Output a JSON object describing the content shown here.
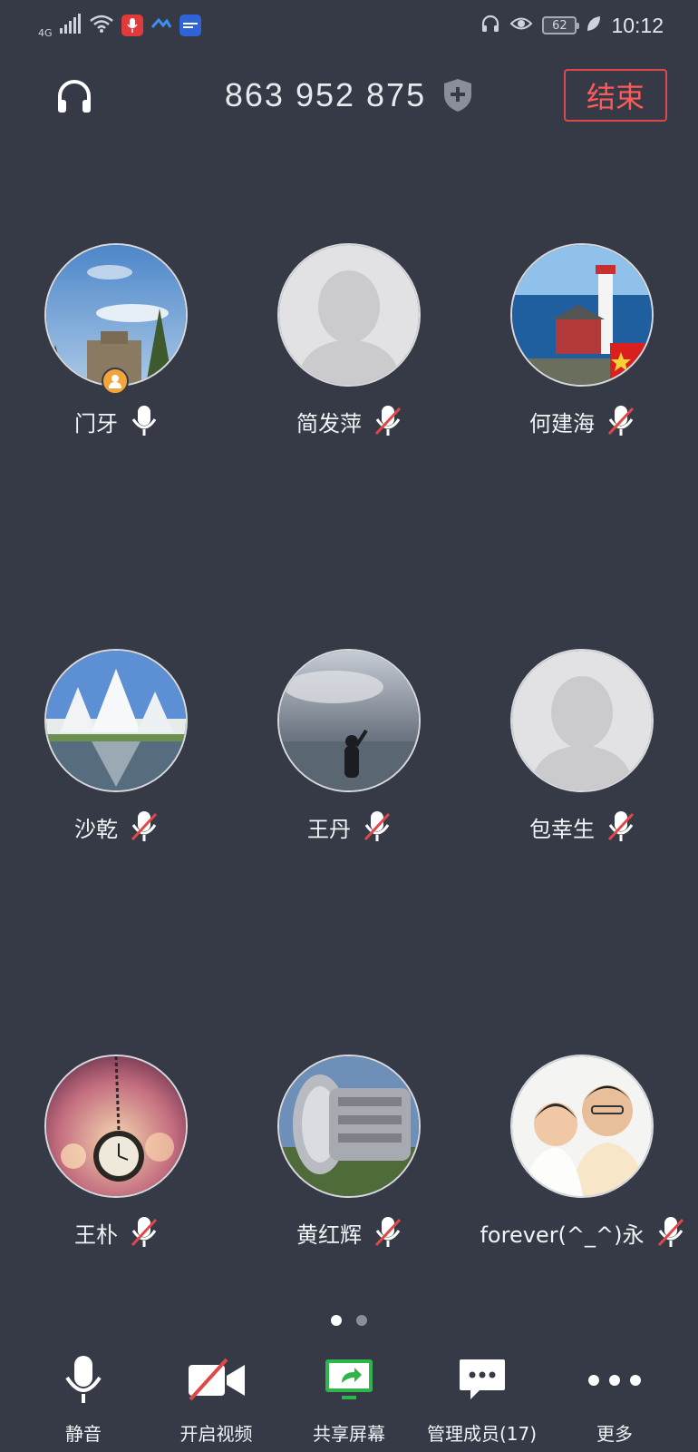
{
  "status_bar": {
    "network": "4G",
    "battery": "62",
    "time": "10:12"
  },
  "header": {
    "meeting_id": "863 952 875",
    "end_label": "结束"
  },
  "participants": [
    {
      "name": "门牙",
      "mic": "on",
      "host": true,
      "avatar": "sky-building-photo"
    },
    {
      "name": "简发萍",
      "mic": "muted",
      "host": false,
      "avatar": "default-avatar"
    },
    {
      "name": "何建海",
      "mic": "muted",
      "host": false,
      "avatar": "lighthouse-photo"
    },
    {
      "name": "沙乾",
      "mic": "muted",
      "host": false,
      "avatar": "white-temple-photo"
    },
    {
      "name": "王丹",
      "mic": "muted",
      "host": false,
      "avatar": "sea-person-photo"
    },
    {
      "name": "包幸生",
      "mic": "muted",
      "host": false,
      "avatar": "default-avatar"
    },
    {
      "name": "王朴",
      "mic": "muted",
      "host": false,
      "avatar": "pocket-watch-photo"
    },
    {
      "name": "黄红辉",
      "mic": "muted",
      "host": false,
      "avatar": "engine-photo"
    },
    {
      "name": "forever(^_^)永",
      "mic": "muted",
      "host": false,
      "avatar": "father-son-photo"
    }
  ],
  "pagination": {
    "current": 1,
    "total": 2
  },
  "toolbar": {
    "mute": "静音",
    "video": "开启视频",
    "share": "共享屏幕",
    "members": "管理成员(17)",
    "more": "更多"
  },
  "colors": {
    "background": "#363a46",
    "end_red": "#e04848",
    "share_green": "#2fb34a",
    "host_badge": "#f2a53b"
  }
}
